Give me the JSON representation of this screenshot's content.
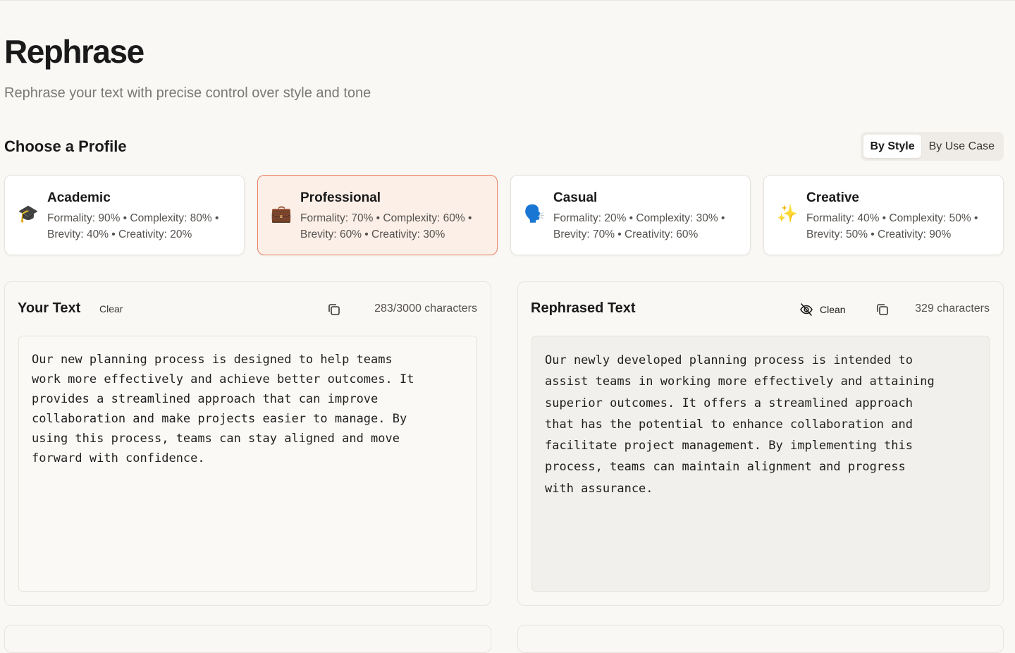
{
  "header": {
    "title": "Rephrase",
    "subtitle": "Rephrase your text with precise control over style and tone"
  },
  "profiles_section": {
    "title": "Choose a Profile",
    "toggle": {
      "options": [
        "By Style",
        "By Use Case"
      ],
      "selected": "By Style"
    },
    "profiles": [
      {
        "name": "Academic",
        "icon": "graduation-cap-icon",
        "emoji": "🎓",
        "details": "Formality: 90% • Complexity: 80% • Brevity: 40% • Creativity: 20%",
        "selected": false
      },
      {
        "name": "Professional",
        "icon": "briefcase-icon",
        "emoji": "💼",
        "details": "Formality: 70% • Complexity: 60% • Brevity: 60% • Creativity: 30%",
        "selected": true
      },
      {
        "name": "Casual",
        "icon": "speaking-head-icon",
        "emoji": "🗣️",
        "details": "Formality: 20% • Complexity: 30% • Brevity: 70% • Creativity: 60%",
        "selected": false
      },
      {
        "name": "Creative",
        "icon": "sparkles-icon",
        "emoji": "✨",
        "details": "Formality: 40% • Complexity: 50% • Brevity: 50% • Creativity: 90%",
        "selected": false
      }
    ]
  },
  "input_panel": {
    "title": "Your Text",
    "clear_label": "Clear",
    "count": "283/3000 characters",
    "text": "Our new planning process is designed to help teams\nwork more effectively and achieve better outcomes. It\nprovides a streamlined approach that can improve\ncollaboration and make projects easier to manage. By\nusing this process, teams can stay aligned and move\nforward with confidence."
  },
  "output_panel": {
    "title": "Rephrased Text",
    "clean_label": "Clean",
    "count": "329 characters",
    "text": "Our newly developed planning process is intended to\nassist teams in working more effectively and attaining\nsuperior outcomes. It offers a streamlined approach\nthat has the potential to enhance collaboration and\nfacilitate project management. By implementing this\nprocess, teams can maintain alignment and progress\nwith assurance."
  },
  "colors": {
    "background": "#faf8f5",
    "accent_border": "#e98462",
    "accent_bg": "#fcefe8"
  }
}
